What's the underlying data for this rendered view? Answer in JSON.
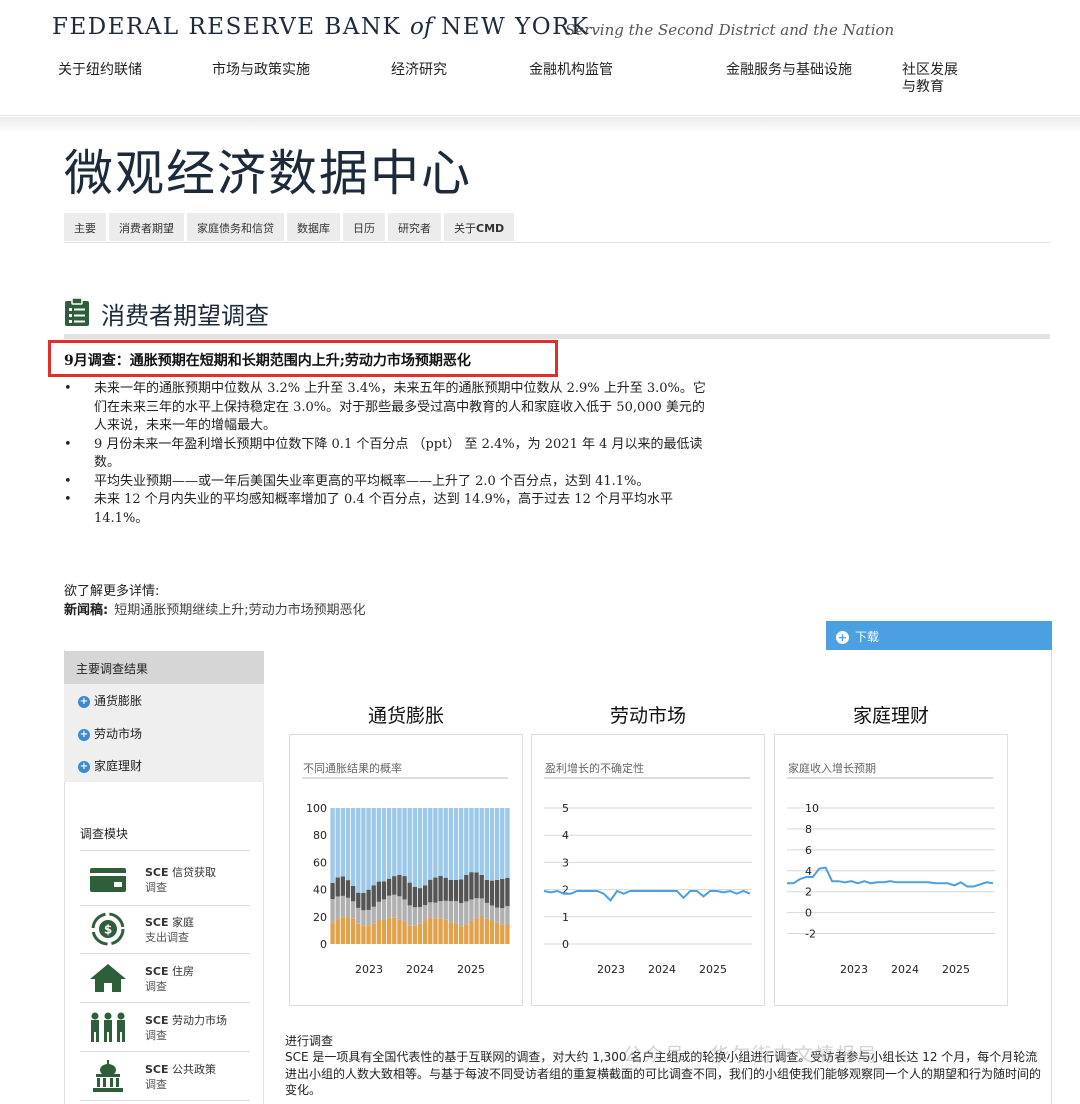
{
  "header": {
    "brand_main": "FEDERAL RESERVE BANK",
    "brand_of": "of",
    "brand_city": "NEW YORK",
    "tagline": "Serving the Second District and the Nation",
    "nav": [
      "关于纽约联储",
      "市场与政策实施",
      "经济研究",
      "金融机构监管",
      "金融服务与基础设施",
      "社区发展与教育"
    ]
  },
  "page_title": "微观经济数据中心",
  "tabs": [
    "主要",
    "消费者期望",
    "家庭债务和信贷",
    "数据库",
    "日历",
    "研究者",
    "关于"
  ],
  "tab_bold_suffix": "CMD",
  "section": {
    "icon": "clipboard-icon",
    "title": "消费者期望调查",
    "headline": "9月调查：通胀预期在短期和长期范围内上升;劳动力市场预期恶化",
    "bullets": [
      "未来一年的通胀预期中位数从 3.2% 上升至 3.4%，未来五年的通胀预期中位数从 2.9% 上升至 3.0%。它们在未来三年的水平上保持稳定在 3.0%。对于那些最多受过高中教育的人和家庭收入低于 50,000 美元的人来说，未来一年的增幅最大。",
      "9 月份未来一年盈利增长预期中位数下降 0.1 个百分点 （ppt） 至 2.4%，为 2021 年 4 月以来的最低读数。",
      "平均失业预期——或一年后美国失业率更高的平均概率——上升了 2.0 个百分点，达到 41.1%。",
      "未来 12 个月内失业的平均感知概率增加了 0.4 个百分点，达到 14.9%，高于过去 12 个月平均水平 14.1%。"
    ],
    "more_label": "欲了解更多详情:",
    "press_label": "新闻稿:",
    "press_link": "短期通胀预期继续上升;劳动力市场预期恶化"
  },
  "download": {
    "icon": "plus-circle-icon",
    "label": "下载"
  },
  "sidebar": {
    "key_results_title": "主要调查结果",
    "key_results": [
      "通货膨胀",
      "劳动市场",
      "家庭理财"
    ],
    "modules_title": "调查模块",
    "modules": [
      {
        "icon": "credit-card-icon",
        "code": "SCE",
        "line1": "信贷获取",
        "line2": "调查"
      },
      {
        "icon": "dollar-cycle-icon",
        "code": "SCE",
        "line1": "家庭",
        "line2": "支出调查"
      },
      {
        "icon": "house-icon",
        "code": "SCE",
        "line1": "住房",
        "line2": "调查"
      },
      {
        "icon": "workers-icon",
        "code": "SCE",
        "line1": "劳动力市场",
        "line2": "调查"
      },
      {
        "icon": "capitol-icon",
        "code": "SCE",
        "line1": "公共政策",
        "line2": "调查"
      }
    ]
  },
  "charts_titles": [
    "通货膨胀",
    "劳动市场",
    "家庭理财"
  ],
  "chart_data": [
    {
      "type": "bar",
      "title": "不同通胀结果的概率",
      "x_tick_labels": [
        "2023",
        "2024",
        "2025"
      ],
      "y_ticks": [
        0,
        20,
        40,
        60,
        80,
        100
      ],
      "ylim": [
        0,
        100
      ],
      "note": "stacked probability bars per month, 100% total",
      "colors": {
        "blue": "#9cc8ea",
        "dark": "#555555",
        "grey": "#b0b0b0",
        "orange": "#e0a24c"
      }
    },
    {
      "type": "line",
      "title": "盈利增长的不确定性",
      "x_tick_labels": [
        "2023",
        "2024",
        "2025"
      ],
      "y_ticks": [
        0,
        1,
        2,
        3,
        4,
        5
      ],
      "ylim": [
        0,
        5
      ],
      "values": [
        1.95,
        1.9,
        1.95,
        1.85,
        1.85,
        1.95,
        1.95,
        1.95,
        1.95,
        1.85,
        1.6,
        1.95,
        1.85,
        1.95,
        1.95,
        1.95,
        1.95,
        1.95,
        1.95,
        1.95,
        1.95,
        1.7,
        1.95,
        1.95,
        1.75,
        1.95,
        1.95,
        1.9,
        1.95,
        1.85,
        1.95,
        1.85
      ],
      "color": "#4aa0e0"
    },
    {
      "type": "line",
      "title": "家庭收入增长预期",
      "x_tick_labels": [
        "2023",
        "2024",
        "2025"
      ],
      "y_ticks": [
        -2,
        0,
        2,
        4,
        6,
        8,
        10
      ],
      "ylim": [
        -3,
        10
      ],
      "values": [
        2.8,
        2.8,
        3.2,
        3.4,
        3.4,
        4.2,
        4.3,
        3.0,
        3.0,
        2.9,
        3.0,
        2.8,
        3.0,
        2.8,
        2.9,
        2.9,
        3.0,
        2.9,
        2.9,
        2.9,
        2.9,
        2.9,
        2.9,
        2.8,
        2.8,
        2.8,
        2.6,
        2.9,
        2.5,
        2.5,
        2.7,
        2.9,
        2.8
      ],
      "color": "#4aa0e0"
    }
  ],
  "ongoing_title": "进行调查",
  "ongoing_desc": "SCE 是一项具有全国代表性的基于互联网的调查，对大约 1,300 名户主组成的轮换小组进行调查。受访者参与小组长达 12 个月，每个月轮流进出小组的人数大致相等。与基于每波不同受访者组的重复横截面的可比调查不同，我们的小组使我们能够观察同一个人的期望和行为随时间的变化。",
  "watermark": "公众号 · 华尔街中文情报局"
}
